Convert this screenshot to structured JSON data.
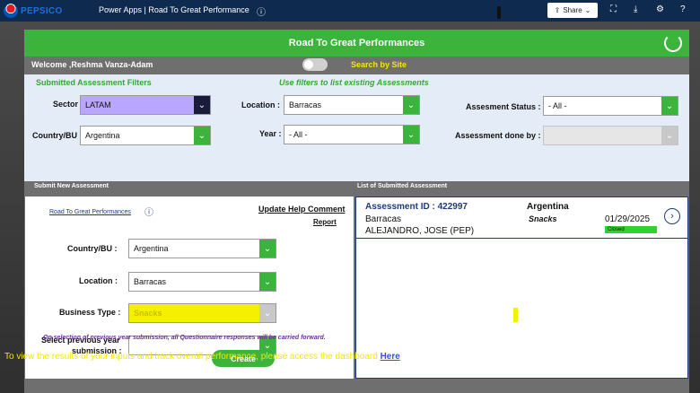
{
  "topbar": {
    "brand": "PEPSICO",
    "app_title": "Power Apps  |  Road To Great Performance",
    "share_label": "Share"
  },
  "header": {
    "title": "Road To Great Performances"
  },
  "welcome": "Welcome ,Reshma Vanza-Adam",
  "search_by_site": "Search by Site",
  "filters": {
    "title": "Submitted Assessment Filters",
    "hint": "Use filters to list existing Assessments",
    "sector_label": "Sector",
    "sector_value": "LATAM",
    "location_label": "Location :",
    "location_value": "Barracas",
    "status_label": "Assesment Status :",
    "status_value": "- All -",
    "country_label": "Country/BU",
    "country_value": "Argentina",
    "year_label": "Year :",
    "year_value": "- All -",
    "done_by_label": "Assessment done by :",
    "done_by_value": ""
  },
  "submit_panel": {
    "header": "Submit New Assessment",
    "rtgp_link": "Road To Great Performances",
    "help_link": "Update Help Comment",
    "report_link": "Report",
    "country_label": "Country/BU :",
    "country_value": "Argentina",
    "location_label": "Location :",
    "location_value": "Barracas",
    "business_label": "Business Type :",
    "business_value": "Snacks",
    "prev_label_1": "Select previous year",
    "prev_label_2": "submission :",
    "prev_value": "",
    "note": "On selection of previous year submission, all Questionnaire responses will be carried forward.",
    "create_label": "Create"
  },
  "list_panel": {
    "header": "List of Submitted Assessment",
    "items": [
      {
        "id": "Assessment ID : 422997",
        "country": "Argentina",
        "location": "Barracas",
        "business": "Snacks",
        "person": "ALEJANDRO, JOSE (PEP)",
        "date": "01/29/2025",
        "status": "Closed"
      }
    ]
  },
  "footer": {
    "text": "To view the results of your inputs and track overall performance, please access the dashboard",
    "link": "Here"
  },
  "colors": {
    "accent": "#3cb43c",
    "navy": "#0f2a4f",
    "highlight": "#f7e600"
  }
}
